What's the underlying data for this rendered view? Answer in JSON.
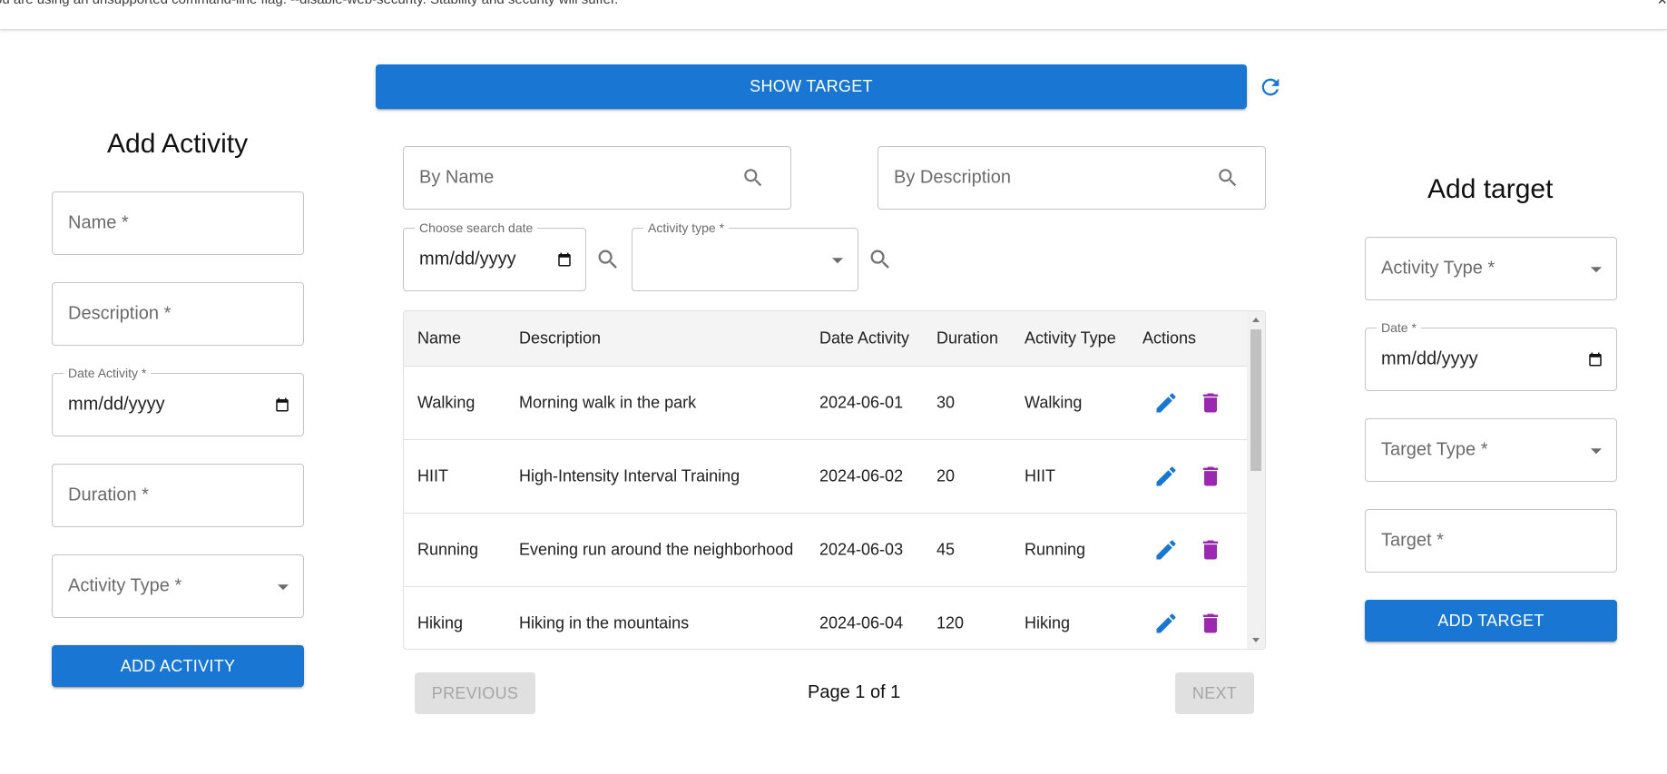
{
  "browser_warning": {
    "text": "ou are using an unsupported command-line flag: --disable-web-security. Stability and security will suffer.",
    "close": "×"
  },
  "toolbar": {
    "show_target_label": "SHOW TARGET",
    "refresh_icon": "refresh-icon"
  },
  "add_activity": {
    "title": "Add Activity",
    "name_placeholder": "Name *",
    "description_placeholder": "Description *",
    "date_label": "Date Activity *",
    "date_value": "mm/dd/yyyy",
    "duration_placeholder": "Duration *",
    "activity_type_placeholder": "Activity Type *",
    "submit_label": "ADD ACTIVITY"
  },
  "filters": {
    "by_name_placeholder": "By Name",
    "by_description_placeholder": "By Description",
    "search_date_label": "Choose search date",
    "search_date_value": "mm/dd/yyyy",
    "activity_type_label": "Activity type *",
    "activity_type_value": ""
  },
  "table": {
    "columns": [
      "Name",
      "Description",
      "Date Activity",
      "Duration",
      "Activity Type",
      "Actions"
    ],
    "rows": [
      {
        "name": "Walking",
        "description": "Morning walk in the park",
        "date": "2024-06-01",
        "duration": "30",
        "type": "Walking"
      },
      {
        "name": "HIIT",
        "description": "High-Intensity Interval Training",
        "date": "2024-06-02",
        "duration": "20",
        "type": "HIIT"
      },
      {
        "name": "Running",
        "description": "Evening run around the neighborhood",
        "date": "2024-06-03",
        "duration": "45",
        "type": "Running"
      },
      {
        "name": "Hiking",
        "description": "Hiking in the mountains",
        "date": "2024-06-04",
        "duration": "120",
        "type": "Hiking"
      }
    ]
  },
  "pagination": {
    "previous_label": "PREVIOUS",
    "page_info": "Page 1 of 1",
    "next_label": "NEXT"
  },
  "add_target": {
    "title": "Add target",
    "activity_type_placeholder": "Activity Type *",
    "date_label": "Date *",
    "date_value": "mm/dd/yyyy",
    "target_type_placeholder": "Target Type *",
    "target_placeholder": "Target *",
    "submit_label": "ADD TARGET"
  },
  "colors": {
    "primary": "#1976d2",
    "edit_icon": "#1976d2",
    "delete_icon": "#9c27b0",
    "disabled_bg": "#e0e0e0"
  }
}
